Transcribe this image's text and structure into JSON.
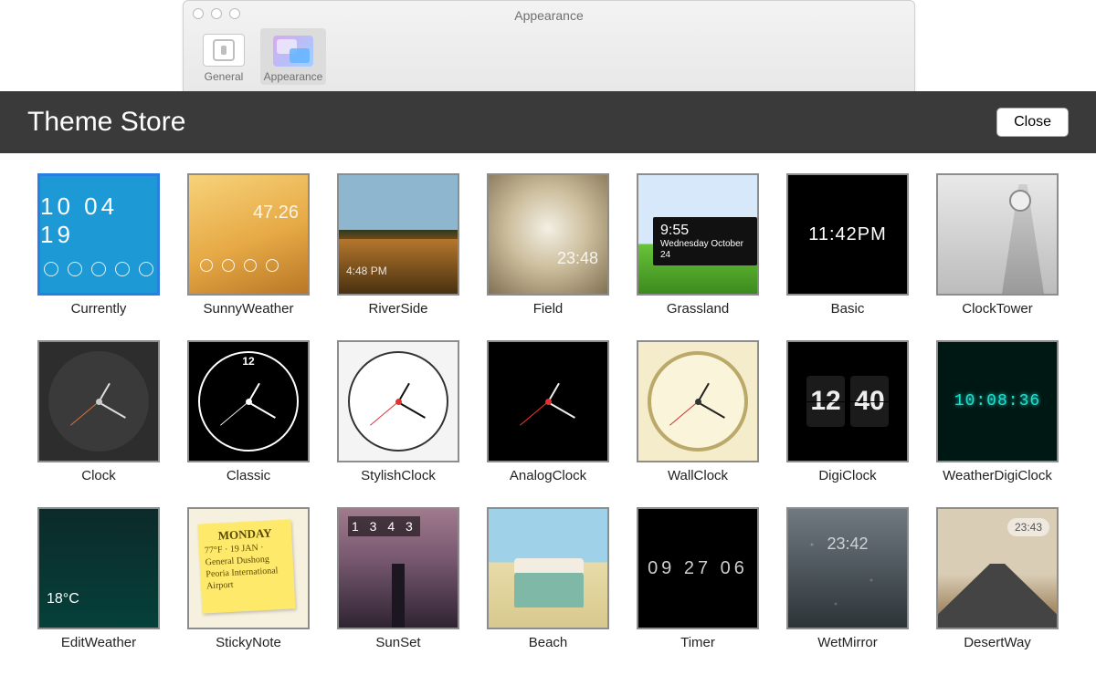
{
  "window": {
    "title": "Appearance",
    "tabs": [
      {
        "id": "general",
        "label": "General"
      },
      {
        "id": "appearance",
        "label": "Appearance"
      }
    ],
    "active_tab": "appearance"
  },
  "store": {
    "title": "Theme Store",
    "close_label": "Close"
  },
  "themes": [
    {
      "id": "currently",
      "name": "Currently",
      "selected": true,
      "overlay_text": "10 04 19"
    },
    {
      "id": "sunnyweather",
      "name": "SunnyWeather",
      "overlay_text": "47.26"
    },
    {
      "id": "riverside",
      "name": "RiverSide",
      "overlay_text": "4:48 PM"
    },
    {
      "id": "field",
      "name": "Field",
      "overlay_text": "23:48"
    },
    {
      "id": "grassland",
      "name": "Grassland",
      "overlay_text": "9:55",
      "overlay_sub": "Wednesday October 24"
    },
    {
      "id": "basic",
      "name": "Basic",
      "overlay_text": "11:42PM"
    },
    {
      "id": "clocktower",
      "name": "ClockTower"
    },
    {
      "id": "clock",
      "name": "Clock"
    },
    {
      "id": "classic",
      "name": "Classic"
    },
    {
      "id": "stylishclock",
      "name": "StylishClock"
    },
    {
      "id": "analogclock",
      "name": "AnalogClock"
    },
    {
      "id": "wallclock",
      "name": "WallClock"
    },
    {
      "id": "digiclock",
      "name": "DigiClock",
      "overlay_text": "12 40"
    },
    {
      "id": "weatherdigiclock",
      "name": "WeatherDigiClock",
      "overlay_text": "10:08:36"
    },
    {
      "id": "editweather",
      "name": "EditWeather",
      "overlay_text": "18°C"
    },
    {
      "id": "stickynote",
      "name": "StickyNote",
      "overlay_text": "MONDAY",
      "overlay_sub": "77°F · 19 JAN · General Dushong Peoria International Airport"
    },
    {
      "id": "sunset",
      "name": "SunSet",
      "overlay_text": "1343"
    },
    {
      "id": "beach",
      "name": "Beach"
    },
    {
      "id": "timer",
      "name": "Timer",
      "overlay_text": "09 27 06"
    },
    {
      "id": "wetmirror",
      "name": "WetMirror",
      "overlay_text": "23:42"
    },
    {
      "id": "desertway",
      "name": "DesertWay",
      "overlay_text": "23:43"
    }
  ]
}
